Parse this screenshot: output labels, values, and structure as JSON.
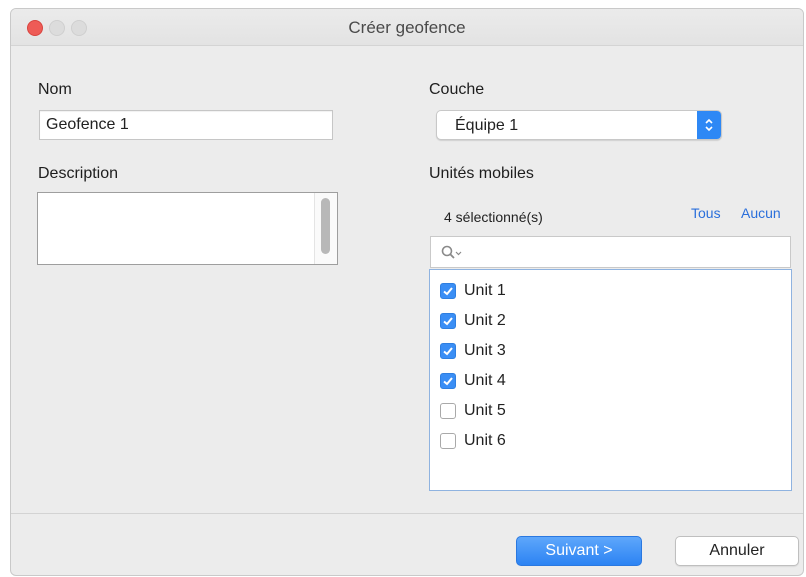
{
  "window": {
    "title": "Créer geofence"
  },
  "name": {
    "label": "Nom",
    "value": "Geofence 1"
  },
  "description": {
    "label": "Description",
    "value": ""
  },
  "layer": {
    "label": "Couche",
    "selected": "Équipe 1"
  },
  "mobile_units": {
    "label": "Unités mobiles",
    "selected_count": "4 sélectionné(s)",
    "select_all": "Tous",
    "select_none": "Aucun",
    "search_placeholder": "",
    "items": [
      {
        "label": "Unit 1",
        "checked": true
      },
      {
        "label": "Unit 2",
        "checked": true
      },
      {
        "label": "Unit 3",
        "checked": true
      },
      {
        "label": "Unit 4",
        "checked": true
      },
      {
        "label": "Unit 5",
        "checked": false
      },
      {
        "label": "Unit 6",
        "checked": false
      }
    ]
  },
  "buttons": {
    "next": "Suivant >",
    "cancel": "Annuler"
  },
  "colors": {
    "accent": "#2e88f5",
    "close": "#ee5b56"
  },
  "icons": {
    "search": "search-icon",
    "checkbox": "checkmark-icon",
    "popup": "up-down-arrows-icon"
  }
}
